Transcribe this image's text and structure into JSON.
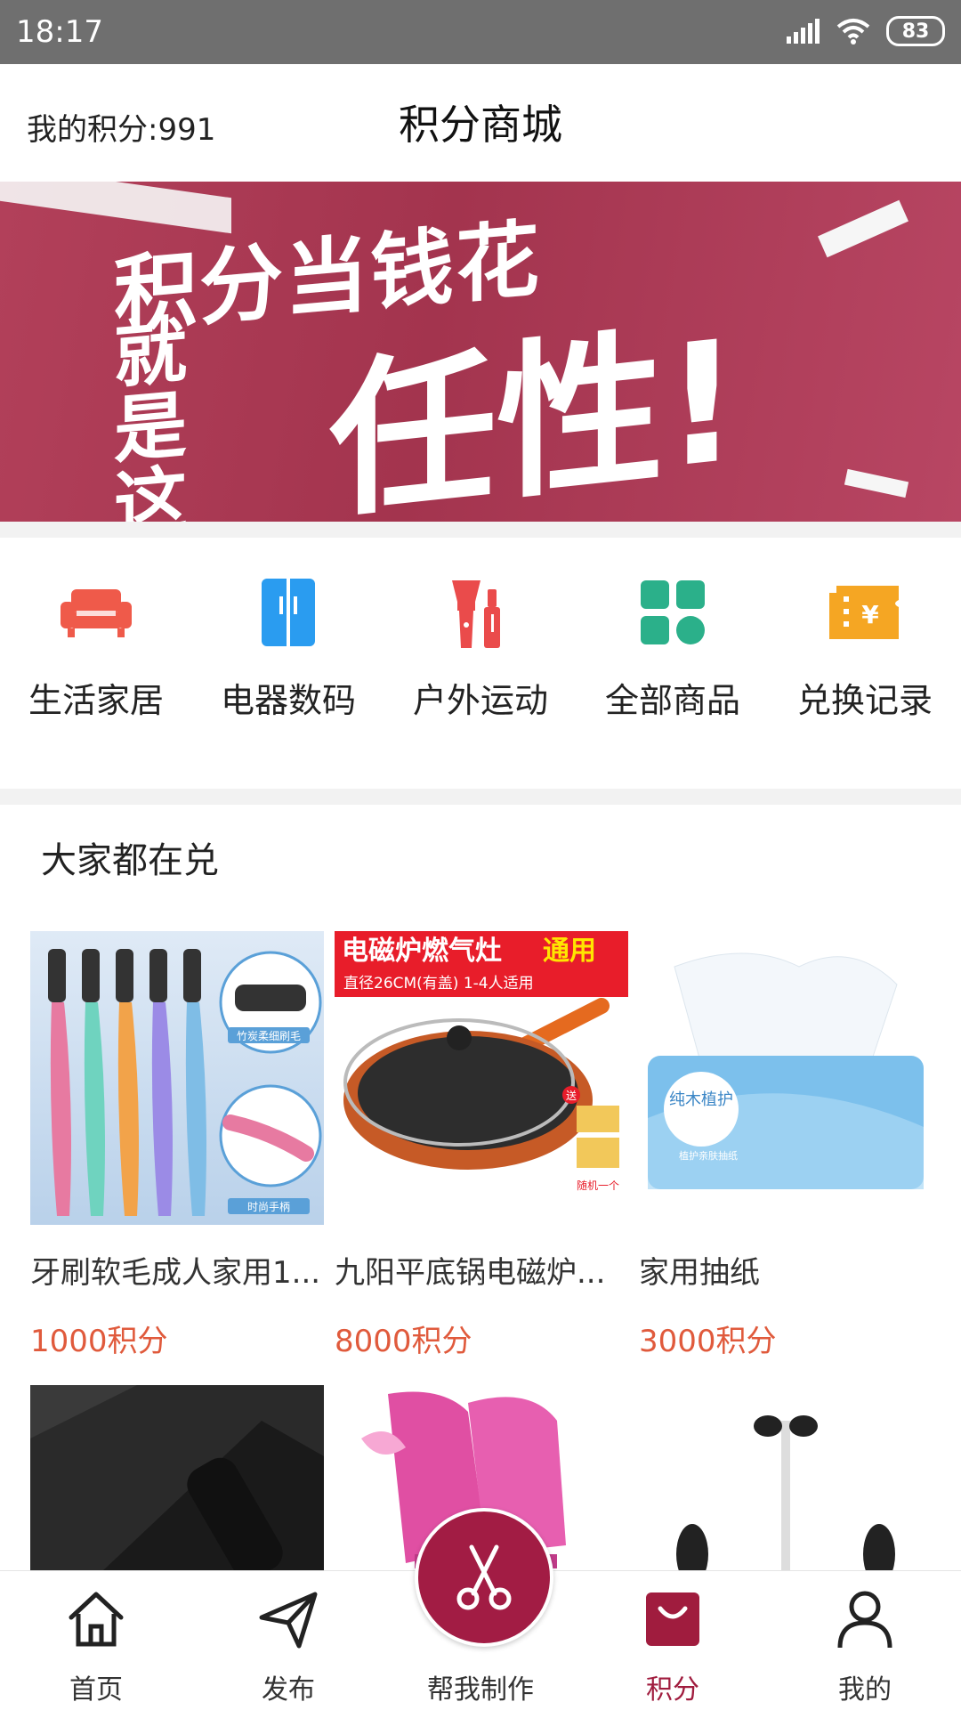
{
  "status_bar": {
    "time": "18:17",
    "battery": "83"
  },
  "header": {
    "points_text": "我的积分:991",
    "title": "积分商城"
  },
  "banner": {
    "line1": "积分当钱花",
    "line2a": "就是",
    "line2b": "这么",
    "highlight": "任性!"
  },
  "categories": [
    {
      "label": "生活家居",
      "icon": "sofa-icon",
      "color": "#ef5a4a"
    },
    {
      "label": "电器数码",
      "icon": "fridge-icon",
      "color": "#2a9cf0"
    },
    {
      "label": "户外运动",
      "icon": "makeup-brush-icon",
      "color": "#ea4b4b"
    },
    {
      "label": "全部商品",
      "icon": "grid-icon",
      "color": "#2bb08a"
    },
    {
      "label": "兑换记录",
      "icon": "ticket-icon",
      "color": "#f5a623"
    }
  ],
  "section": {
    "title": "大家都在兑"
  },
  "products": [
    {
      "name": "牙刷软毛成人家用1...",
      "price": "1000积分",
      "image": "toothbrush-set",
      "tag1": "竹炭柔细刷毛",
      "tag2": "时尚手柄"
    },
    {
      "name": "九阳平底锅电磁炉...",
      "price": "8000积分",
      "image": "frying-pan",
      "banner_a": "电磁炉燃气灶",
      "banner_b": "通用",
      "sub": "直径26CM(有盖) 1-4人适用",
      "gift": "送",
      "gift2": "随机一个"
    },
    {
      "name": "家用抽纸",
      "price": "3000积分",
      "image": "tissue-box",
      "brand": "纯木植护",
      "sub": "植护亲肤抽纸"
    },
    {
      "name": "",
      "price": "",
      "image": "thermos-box"
    },
    {
      "name": "",
      "price": "",
      "image": "roller-skates"
    },
    {
      "name": "",
      "price": "",
      "image": "self-balancing-scooter"
    }
  ],
  "tabbar": {
    "tabs": [
      {
        "label": "首页",
        "icon": "home-icon"
      },
      {
        "label": "发布",
        "icon": "paper-plane-icon"
      },
      {
        "label": "帮我制作",
        "icon": "scissors-icon"
      },
      {
        "label": "积分",
        "icon": "shopping-bag-icon"
      },
      {
        "label": "我的",
        "icon": "person-icon"
      }
    ],
    "active_color": "#a01c3e"
  }
}
